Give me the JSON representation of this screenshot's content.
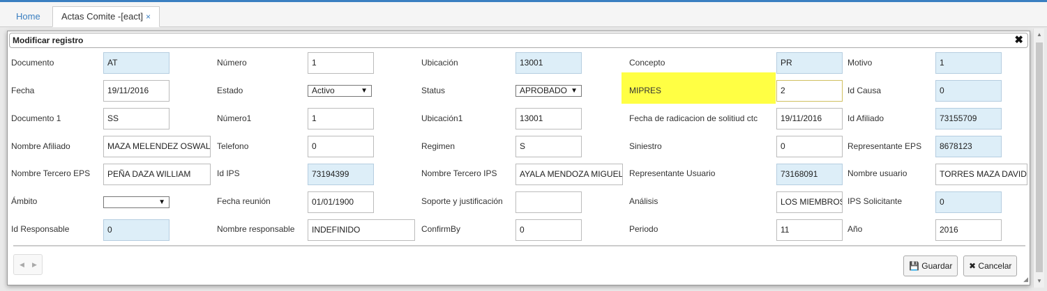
{
  "tabs": {
    "home": "Home",
    "active": "Actas Comite -[eact]",
    "close": "×"
  },
  "dialog": {
    "title": "Modificar registro",
    "close": "✖"
  },
  "col1": {
    "documento": {
      "label": "Documento",
      "value": "AT"
    },
    "fecha": {
      "label": "Fecha",
      "value": "19/11/2016"
    },
    "documento1": {
      "label": "Documento 1",
      "value": "SS"
    },
    "nombre_afiliado": {
      "label": "Nombre Afiliado",
      "value": "MAZA MELENDEZ OSWALDO"
    },
    "nombre_tercero_eps": {
      "label": "Nombre Tercero EPS",
      "value": "PEÑA DAZA WILLIAM"
    },
    "ambito": {
      "label": "Ámbito",
      "value": ""
    },
    "id_responsable": {
      "label": "Id Responsable",
      "value": "0"
    }
  },
  "col2": {
    "numero": {
      "label": "Número",
      "value": "1"
    },
    "estado": {
      "label": "Estado",
      "value": "Activo"
    },
    "numero1": {
      "label": "Número1",
      "value": "1"
    },
    "telefono": {
      "label": "Telefono",
      "value": "0"
    },
    "id_ips": {
      "label": "Id IPS",
      "value": "73194399"
    },
    "fecha_reunion": {
      "label": "Fecha reunión",
      "value": "01/01/1900"
    },
    "nombre_responsable": {
      "label": "Nombre responsable",
      "value": "INDEFINIDO"
    }
  },
  "col3": {
    "ubicacion": {
      "label": "Ubicación",
      "value": "13001"
    },
    "status": {
      "label": "Status",
      "value": "APROBADO"
    },
    "ubicacion1": {
      "label": "Ubicación1",
      "value": "13001"
    },
    "regimen": {
      "label": "Regimen",
      "value": "S"
    },
    "nombre_tercero_ips": {
      "label": "Nombre Tercero IPS",
      "value": "AYALA MENDOZA MIGUEL"
    },
    "soporte": {
      "label": "Soporte y justificación",
      "value": ""
    },
    "confirmby": {
      "label": "ConfirmBy",
      "value": "0"
    }
  },
  "col4": {
    "concepto": {
      "label": "Concepto",
      "value": "PR"
    },
    "mipres": {
      "label": "MIPRES",
      "value": "2"
    },
    "fecha_radicacion": {
      "label": "Fecha de radicacion de solitiud ctc",
      "value": "19/11/2016"
    },
    "siniestro": {
      "label": "Siniestro",
      "value": "0"
    },
    "representante_usuario": {
      "label": "Representante Usuario",
      "value": "73168091"
    },
    "analisis": {
      "label": "Análisis",
      "value": "LOS MIEMBROS"
    },
    "periodo": {
      "label": "Periodo",
      "value": "11"
    }
  },
  "col5": {
    "motivo": {
      "label": "Motivo",
      "value": "1"
    },
    "id_causa": {
      "label": "Id Causa",
      "value": "0"
    },
    "id_afiliado": {
      "label": "Id Afiliado",
      "value": "73155709"
    },
    "representante_eps": {
      "label": "Representante EPS",
      "value": "8678123"
    },
    "nombre_usuario": {
      "label": "Nombre usuario",
      "value": "TORRES MAZA DAVID"
    },
    "ips_solicitante": {
      "label": "IPS Solicitante",
      "value": "0"
    },
    "anio": {
      "label": "Año",
      "value": "2016"
    }
  },
  "footer": {
    "pager_prev": "◀",
    "pager_next": "▶",
    "save": "Guardar",
    "cancel": "Cancelar"
  },
  "icons": {
    "save": "floppy-icon",
    "cancel": "x-icon"
  },
  "colors": {
    "accent": "#3a7fc1",
    "readonly": "#ddeef8",
    "highlight": "#ffff44"
  }
}
